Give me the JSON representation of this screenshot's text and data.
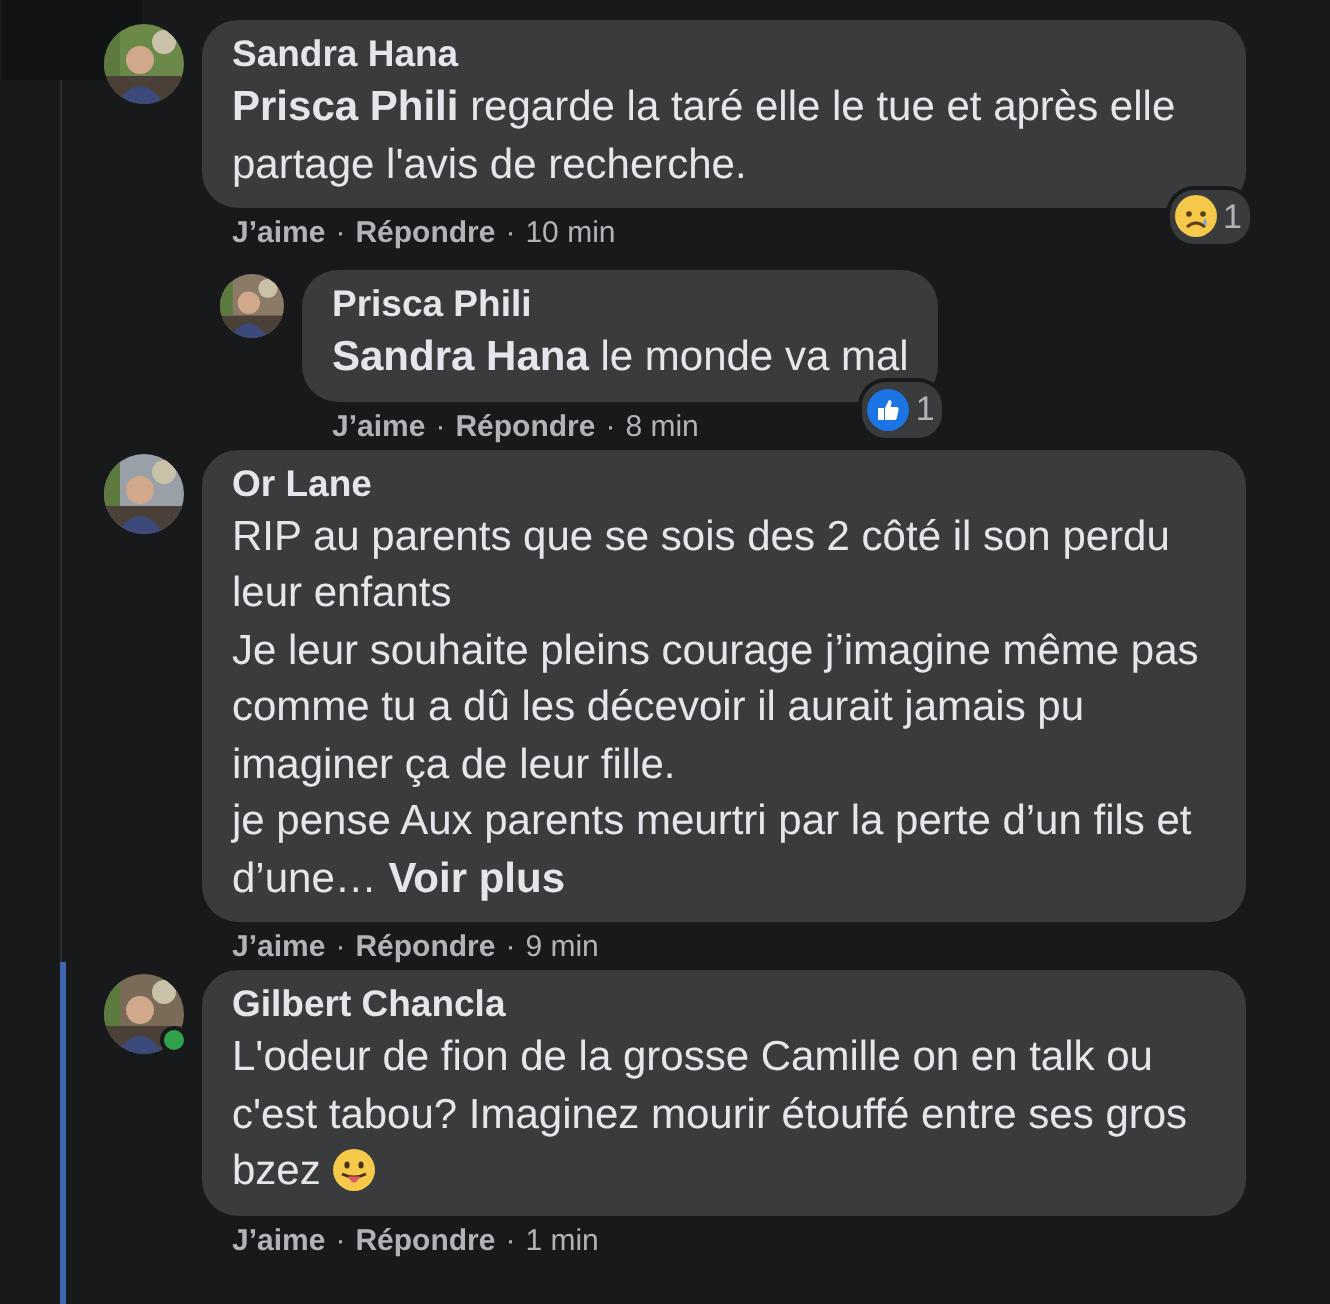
{
  "comments": [
    {
      "author": "Sandra Hana",
      "body": [
        "**Prisca Phili** regarde la taré elle le tue et après elle partage l'avis de recherche."
      ],
      "reaction": {
        "kind": "sad",
        "count": "1"
      },
      "meta": [
        {
          "kind": "link",
          "text": "J’aime"
        },
        {
          "kind": "sep",
          "text": "·"
        },
        {
          "kind": "link",
          "text": "Répondre"
        },
        {
          "kind": "sep",
          "text": "·"
        },
        {
          "kind": "time",
          "text": "10 min"
        }
      ],
      "online": false,
      "thread_line": false,
      "replies": [
        {
          "author": "Prisca Phili",
          "body": [
            "**Sandra Hana** le monde va mal"
          ],
          "reaction": {
            "kind": "like",
            "count": "1"
          },
          "meta": [
            {
              "kind": "link",
              "text": "J’aime"
            },
            {
              "kind": "sep",
              "text": "·"
            },
            {
              "kind": "link",
              "text": "Répondre"
            },
            {
              "kind": "sep",
              "text": "·"
            },
            {
              "kind": "time",
              "text": "8 min"
            }
          ],
          "online": false,
          "thread_line": false
        }
      ]
    },
    {
      "author": "Or Lane",
      "body": [
        "RIP au parents que se sois des 2 côté il son perdu leur enfants",
        "Je leur souhaite pleins courage j’imagine même pas comme tu a dû les décevoir il aurait jamais pu imaginer ça de leur fille.",
        "je pense Aux parents meurtri par la perte d’un fils et d’une…"
      ],
      "see_more": "Voir plus",
      "meta": [
        {
          "kind": "link",
          "text": "J’aime"
        },
        {
          "kind": "sep",
          "text": "·"
        },
        {
          "kind": "link",
          "text": "Répondre"
        },
        {
          "kind": "sep",
          "text": "·"
        },
        {
          "kind": "time",
          "text": "9 min"
        }
      ],
      "online": false,
      "thread_line": false
    },
    {
      "author": "Gilbert Chancla",
      "body": [
        "L'odeur de fion de la grosse Camille on en talk ou c'est tabou? Imaginez mourir étouffé entre ses gros bzez"
      ],
      "emoji": {
        "kind": "tongue"
      },
      "meta": [
        {
          "kind": "link",
          "text": "J’aime"
        },
        {
          "kind": "sep",
          "text": "·"
        },
        {
          "kind": "link",
          "text": "Répondre"
        },
        {
          "kind": "sep",
          "text": "·"
        },
        {
          "kind": "time",
          "text": "1 min"
        }
      ],
      "online": true,
      "thread_line": true
    }
  ]
}
